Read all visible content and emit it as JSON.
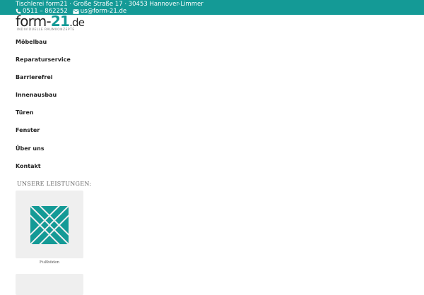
{
  "topbar": {
    "address": "Tischlerei form21 · Große Straße 17 · 30453 Hannover-Limmer",
    "phone": "0511 – 862252",
    "email": "us@form-21.de",
    "phone_icon": "phone-icon",
    "email_icon": "envelope-icon",
    "background": "#149a96"
  },
  "logo": {
    "word_part1": "form-",
    "word_part2": "21",
    "word_part3": ".de",
    "tagline": "INDIVIDUELLE RAUMKONZEPTE",
    "accent_color": "#149a96"
  },
  "nav": {
    "items": [
      {
        "label": "Möbelbau"
      },
      {
        "label": "Reparaturservice"
      },
      {
        "label": "Barrierefrei"
      },
      {
        "label": "Innenausbau"
      },
      {
        "label": "Türen"
      },
      {
        "label": "Fenster"
      },
      {
        "label": "Über uns"
      },
      {
        "label": "Kontakt"
      }
    ]
  },
  "services": {
    "title": "UNSERE LEISTUNGEN:",
    "cards": [
      {
        "caption": "Fußböden",
        "icon": "parquet-floor-icon"
      }
    ]
  }
}
